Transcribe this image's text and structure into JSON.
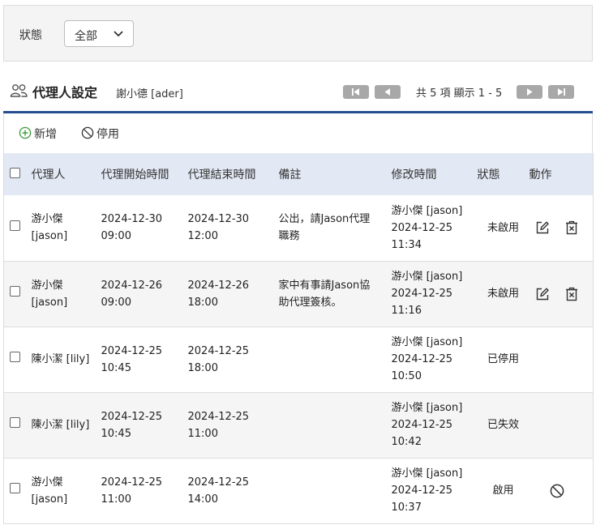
{
  "filter": {
    "label": "狀態",
    "selected": "全部"
  },
  "header": {
    "title": "代理人設定",
    "user": "謝小德 [ader]",
    "page_info": "共 5 項 顯示 1 - 5"
  },
  "toolbar": {
    "add_label": "新增",
    "disable_label": "停用"
  },
  "columns": {
    "proxy": "代理人",
    "start": "代理開始時間",
    "end": "代理結束時間",
    "note": "備註",
    "modified": "修改時間",
    "status": "狀態",
    "action": "動作"
  },
  "rows": [
    {
      "proxy": "游小傑\n[jason]",
      "start": "2024-12-30\n09:00",
      "end": "2024-12-30\n12:00",
      "note": "公出，請Jason代理\n職務",
      "modified": "游小傑 [jason]\n2024-12-25\n11:34",
      "status": "未啟用"
    },
    {
      "proxy": "游小傑\n[jason]",
      "start": "2024-12-26\n09:00",
      "end": "2024-12-26\n18:00",
      "note": "家中有事請Jason協\n助代理簽核。",
      "modified": "游小傑 [jason]\n2024-12-25\n11:16",
      "status": "未啟用"
    },
    {
      "proxy": "陳小潔 [lily]",
      "start": "2024-12-25\n10:45",
      "end": "2024-12-25\n18:00",
      "note": "",
      "modified": "游小傑 [jason]\n2024-12-25\n10:50",
      "status": "已停用"
    },
    {
      "proxy": "陳小潔 [lily]",
      "start": "2024-12-25\n10:45",
      "end": "2024-12-25\n11:00",
      "note": "",
      "modified": "游小傑 [jason]\n2024-12-25\n10:42",
      "status": "已失效"
    },
    {
      "proxy": "游小傑\n[jason]",
      "start": "2024-12-25\n11:00",
      "end": "2024-12-25\n14:00",
      "note": "",
      "modified": "游小傑 [jason]\n2024-12-25\n10:37",
      "status": "啟用"
    }
  ],
  "colors": {
    "accent_rule": "#264f8f",
    "header_bg": "#e3e9f4",
    "status_inactive": "#1f66c4",
    "status_disabled": "#777777",
    "status_expired": "#e00000",
    "status_active": "#2a7a2a",
    "add_icon": "#3a9a3a"
  },
  "icons": {
    "add": "plus-circle-icon",
    "disable": "ban-icon",
    "edit": "edit-icon",
    "delete": "trash-icon",
    "section": "people-icon",
    "dropdown": "chevron-down-icon",
    "paging": [
      "first-page-icon",
      "prev-page-icon",
      "next-page-icon",
      "last-page-icon"
    ]
  }
}
